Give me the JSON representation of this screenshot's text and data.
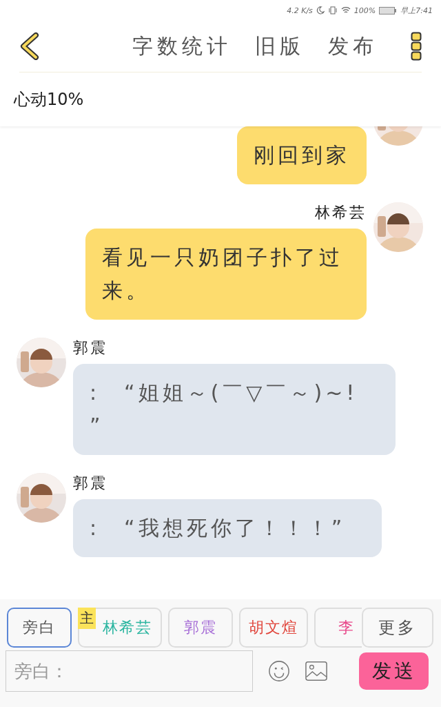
{
  "status_bar": {
    "speed": "4.2 K/s",
    "battery": "100%",
    "time": "早上7:41"
  },
  "header": {
    "actions": [
      "字数统计",
      "旧版",
      "发布"
    ]
  },
  "subtitle": "心动10%",
  "messages": [
    {
      "kind": "outgoing",
      "text": "刚回到家"
    },
    {
      "kind": "outgoing",
      "name": "林希芸",
      "text": "看见一只奶团子扑了过来。"
    },
    {
      "kind": "incoming",
      "name": "郭震",
      "text": ":　“姐姐～(￣▽￣～)~! ”"
    },
    {
      "kind": "incoming",
      "name": "郭震",
      "text": ":　“我想死你了！！！”"
    }
  ],
  "roles": [
    {
      "label": "旁白",
      "selected": true,
      "color": "#555555"
    },
    {
      "label": "林希芸",
      "selected": false,
      "color": "#2bb5a0",
      "badge": "主"
    },
    {
      "label": "郭震",
      "selected": false,
      "color": "#a56bd6"
    },
    {
      "label": "胡文煊",
      "selected": false,
      "color": "#e0443a"
    },
    {
      "label": "李",
      "selected": false,
      "color": "#e8488a"
    }
  ],
  "more": "更多",
  "input": {
    "placeholder": "旁白："
  },
  "send": "发送"
}
